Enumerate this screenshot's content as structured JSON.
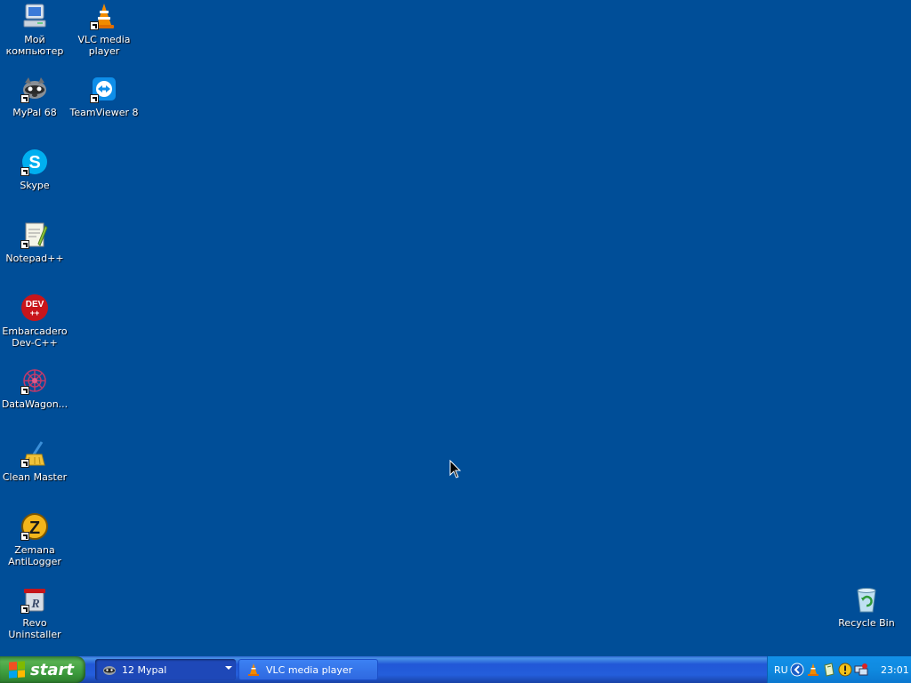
{
  "desktop": {
    "background_color": "#004e98",
    "icons": [
      {
        "name": "my-computer",
        "label": "Мой\nкомпьютер"
      },
      {
        "name": "vlc",
        "label": "VLC media\nplayer"
      },
      {
        "name": "mypal",
        "label": "MyPal 68"
      },
      {
        "name": "teamviewer",
        "label": "TeamViewer 8"
      },
      {
        "name": "skype",
        "label": "Skype"
      },
      {
        "name": "notepadpp",
        "label": "Notepad++"
      },
      {
        "name": "devcpp",
        "label": "Embarcadero\nDev-C++"
      },
      {
        "name": "datawagon",
        "label": "DataWagon..."
      },
      {
        "name": "clean-master",
        "label": "Clean Master"
      },
      {
        "name": "zemana",
        "label": "Zemana\nAntiLogger"
      },
      {
        "name": "revo",
        "label": "Revo\nUninstaller"
      },
      {
        "name": "recycle-bin",
        "label": "Recycle Bin"
      }
    ],
    "devcpp_icon_text": "DEV",
    "skype_icon_text": "S",
    "zemana_icon_text": "Z",
    "revo_icon_text": "R"
  },
  "taskbar": {
    "start_label": "start",
    "tasks": [
      {
        "label": "12 Mypal",
        "icon": "mypal-icon",
        "state": "pressed"
      },
      {
        "label": "VLC media player",
        "icon": "vlc-icon",
        "state": "normal"
      }
    ],
    "tray": {
      "language": "RU",
      "icons": [
        "back-arrow-icon",
        "vlc-tray-icon",
        "document-tray-icon",
        "warning-tray-icon",
        "network-tray-icon"
      ],
      "time": "23:01"
    }
  },
  "colors": {
    "taskbar_blue": "#245edb",
    "start_green": "#3d9c3d",
    "tray_blue": "#0f8ae0"
  }
}
